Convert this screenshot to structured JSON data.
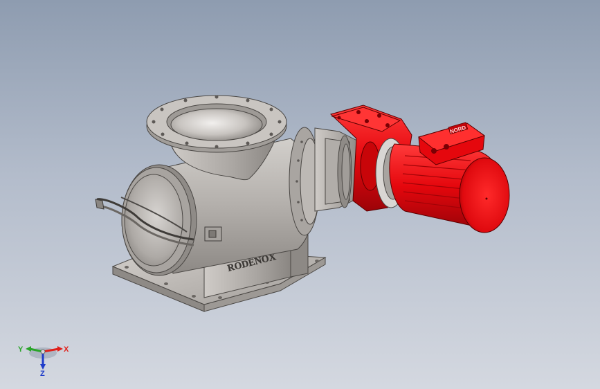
{
  "scene": {
    "type": "CAD 3D model render",
    "background": {
      "top": "#8e9cb0",
      "bottom": "#d4d8e0"
    },
    "valve_color": "#b9b5b1",
    "motor_color": "#e5070d"
  },
  "model": {
    "body_engraving": "RODENOX",
    "motor_label": "NORD"
  },
  "triad": {
    "x_label": "X",
    "y_label": "Y",
    "z_label": "Z",
    "x_color": "#e0201a",
    "y_color": "#2aa52a",
    "z_color": "#1f3cc9"
  }
}
